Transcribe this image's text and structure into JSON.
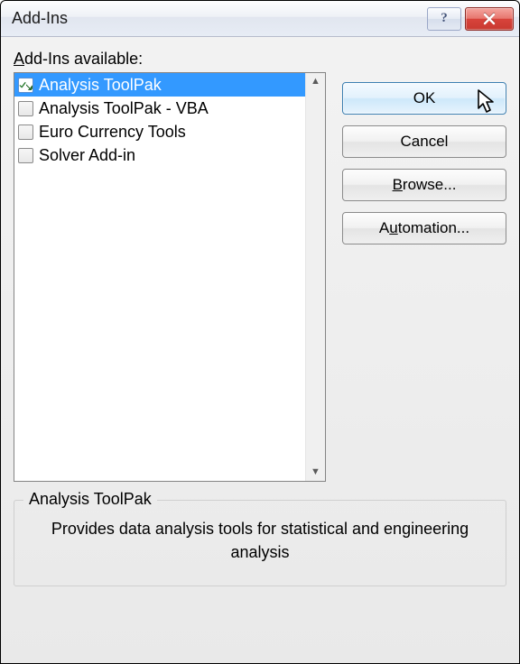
{
  "window": {
    "title": "Add-Ins"
  },
  "list": {
    "label_prefix": "A",
    "label_rest": "dd-Ins available:",
    "items": [
      {
        "label": "Analysis ToolPak",
        "checked": true,
        "selected": true
      },
      {
        "label": "Analysis ToolPak - VBA",
        "checked": false,
        "selected": false
      },
      {
        "label": "Euro Currency Tools",
        "checked": false,
        "selected": false
      },
      {
        "label": "Solver Add-in",
        "checked": false,
        "selected": false
      }
    ]
  },
  "buttons": {
    "ok": "OK",
    "cancel": "Cancel",
    "browse_u": "B",
    "browse_rest": "rowse...",
    "automation_pre": "A",
    "automation_u": "u",
    "automation_rest": "tomation..."
  },
  "description": {
    "title": "Analysis ToolPak",
    "text": "Provides data analysis tools for statistical and engineering analysis"
  }
}
